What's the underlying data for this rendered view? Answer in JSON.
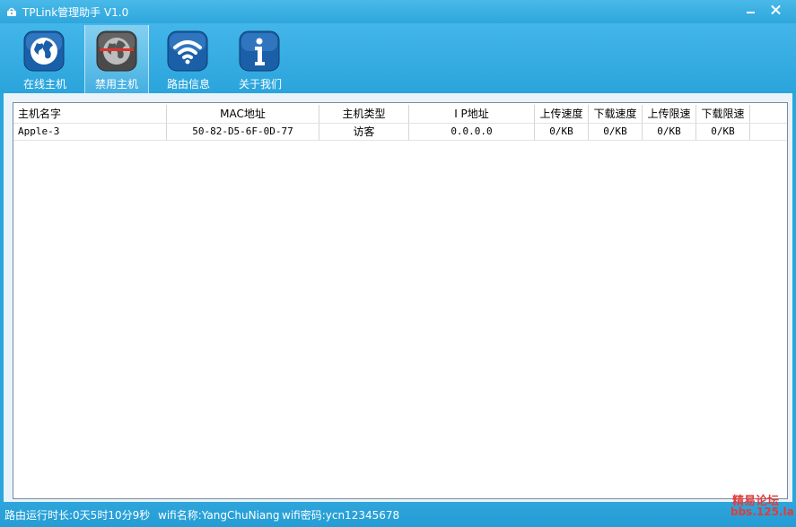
{
  "titlebar": {
    "title": "TPLink管理助手 V1.0"
  },
  "toolbar": {
    "items": [
      {
        "label": "在线主机",
        "icon": "globe-icon",
        "active": false
      },
      {
        "label": "禁用主机",
        "icon": "banned-globe-icon",
        "active": true
      },
      {
        "label": "路由信息",
        "icon": "wifi-icon",
        "active": false
      },
      {
        "label": "关于我们",
        "icon": "info-icon",
        "active": false
      }
    ]
  },
  "table": {
    "columns": [
      "主机名字",
      "MAC地址",
      "主机类型",
      "I P地址",
      "上传速度",
      "下载速度",
      "上传限速",
      "下载限速"
    ],
    "rows": [
      {
        "name": "Apple-3",
        "mac": "50-82-D5-6F-0D-77",
        "type": "访客",
        "ip": "0.0.0.0",
        "up": "0/KB",
        "down": "0/KB",
        "up_limit": "0/KB",
        "down_limit": "0/KB"
      }
    ]
  },
  "status": {
    "uptime": "路由运行时长:0天5时10分9秒",
    "wifi_name": "wifi名称:YangChuNiang",
    "wifi_password": "wifi密码:ycn12345678"
  },
  "watermark": {
    "line1": "精易论坛",
    "line2": "bbs.125.la"
  },
  "colors": {
    "chrome": "#2aa6dc",
    "active_tab": "#7fc9ec",
    "watermark": "#e23b3b"
  }
}
